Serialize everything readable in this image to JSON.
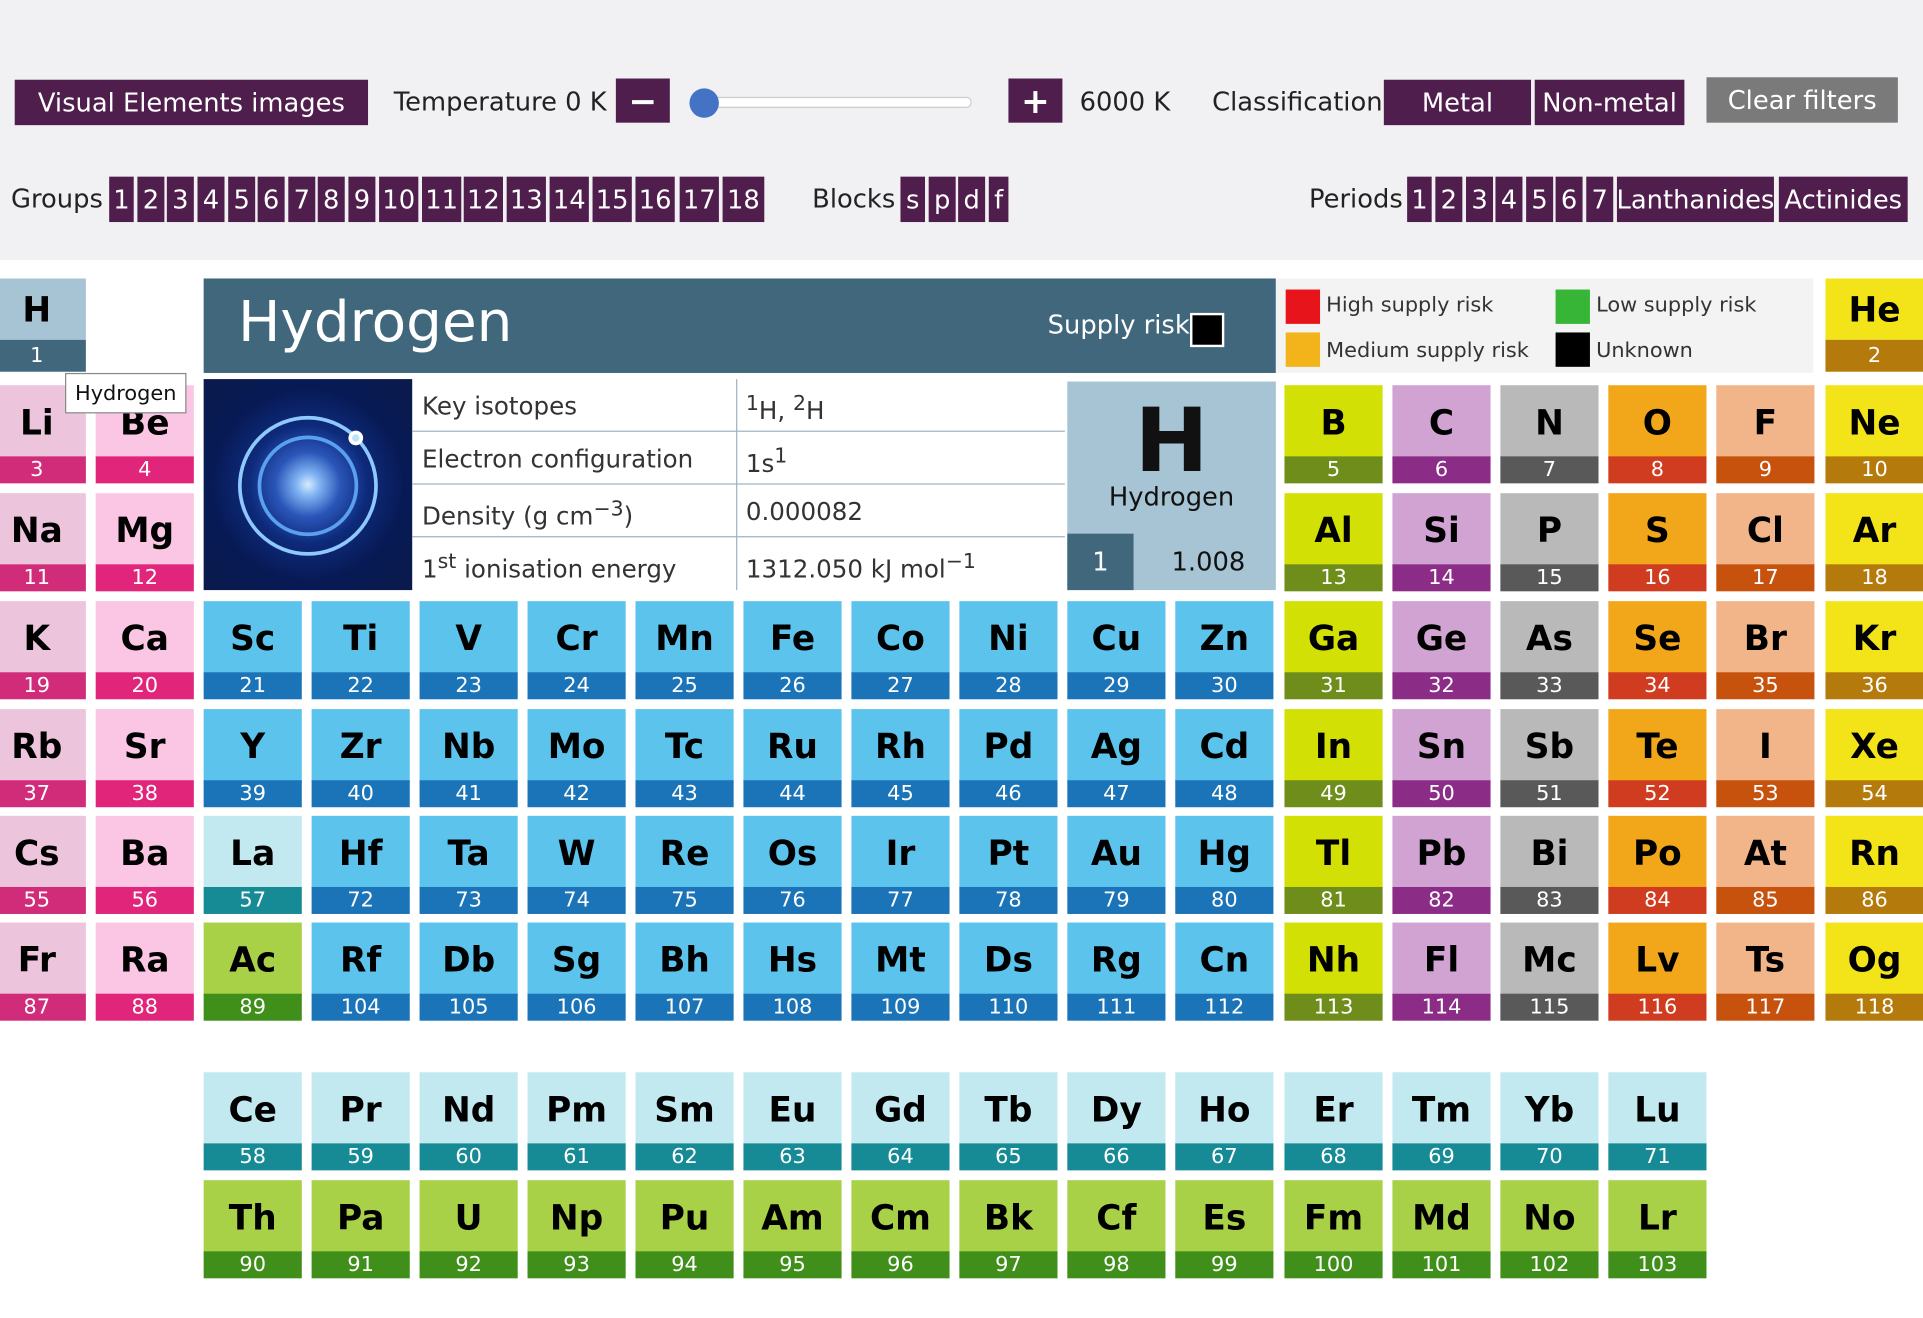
{
  "controls": {
    "images_button": "Visual Elements images",
    "temperature_label": "Temperature 0 K",
    "minus": "−",
    "plus": "+",
    "temperature_max": "6000 K",
    "classification_label": "Classification",
    "metal": "Metal",
    "non_metal": "Non-metal",
    "clear": "Clear filters",
    "temperature_slider_level": 0
  },
  "filters": {
    "groups_label": "Groups",
    "groups": [
      "1",
      "2",
      "3",
      "4",
      "5",
      "6",
      "7",
      "8",
      "9",
      "10",
      "11",
      "12",
      "13",
      "14",
      "15",
      "16",
      "17",
      "18"
    ],
    "blocks_label": "Blocks",
    "blocks": [
      "s",
      "p",
      "d",
      "f"
    ],
    "periods_label": "Periods",
    "periods": [
      "1",
      "2",
      "3",
      "4",
      "5",
      "6",
      "7",
      "Lanthanides",
      "Actinides"
    ]
  },
  "detail": {
    "name": "Hydrogen",
    "supply_risk_label": "Supply risk",
    "symbol": "H",
    "atomic_number": "1",
    "atomic_mass": "1.008",
    "properties": [
      {
        "key": "Key isotopes",
        "value": "1H, 2H"
      },
      {
        "key": "Electron configuration",
        "value": "1s1"
      },
      {
        "key": "Density (g cm−3)",
        "value": "0.000082"
      },
      {
        "key": "1st ionisation energy",
        "value": "1312.050 kJ mol−1"
      }
    ]
  },
  "legend": {
    "high": "High supply risk",
    "medium": "Medium supply risk",
    "low": "Low supply risk",
    "unknown": "Unknown",
    "colors": {
      "high": "#e8141c",
      "medium": "#f2b31b",
      "low": "#36b536",
      "unknown": "#000000"
    }
  },
  "tooltip": "Hydrogen",
  "colors": {
    "accent": "#4f1e4c",
    "detail_header": "#40677c",
    "alkali": [
      "#ecc4dc",
      "#d12c79"
    ],
    "alkaline": [
      "#fac6e3",
      "#e0257a"
    ],
    "transition": [
      "#5cc4ec",
      "#1b74b8"
    ],
    "lanthanide": [
      "#c2e9f0",
      "#178b95"
    ],
    "actinide": [
      "#a8d147",
      "#3f8f1a"
    ],
    "post_transition": [
      "#d3e005",
      "#6f8d1a"
    ],
    "metalloid": [
      "#d1a3d3",
      "#8b2d87"
    ],
    "nonmetal_grey": [
      "#b9b9b9",
      "#595959"
    ],
    "orange": [
      "#f2a71b",
      "#d03c1f"
    ],
    "halogen": [
      "#f2b58a",
      "#c6520e"
    ],
    "noble": [
      "#f2e418",
      "#b57a0c"
    ],
    "hydrogen": [
      "#a7c4d4",
      "#40677c"
    ]
  },
  "elements": [
    {
      "s": "H",
      "n": "1",
      "c": "hydrogen"
    },
    {
      "s": "He",
      "n": "2",
      "c": "noble"
    },
    {
      "s": "Li",
      "n": "3",
      "c": "alkali"
    },
    {
      "s": "Be",
      "n": "4",
      "c": "alkaline"
    },
    {
      "s": "B",
      "n": "5",
      "c": "post_transition"
    },
    {
      "s": "C",
      "n": "6",
      "c": "metalloid"
    },
    {
      "s": "N",
      "n": "7",
      "c": "nonmetal_grey"
    },
    {
      "s": "O",
      "n": "8",
      "c": "orange"
    },
    {
      "s": "F",
      "n": "9",
      "c": "halogen"
    },
    {
      "s": "Ne",
      "n": "10",
      "c": "noble"
    },
    {
      "s": "Na",
      "n": "11",
      "c": "alkali"
    },
    {
      "s": "Mg",
      "n": "12",
      "c": "alkaline"
    },
    {
      "s": "Al",
      "n": "13",
      "c": "post_transition"
    },
    {
      "s": "Si",
      "n": "14",
      "c": "metalloid"
    },
    {
      "s": "P",
      "n": "15",
      "c": "nonmetal_grey"
    },
    {
      "s": "S",
      "n": "16",
      "c": "orange"
    },
    {
      "s": "Cl",
      "n": "17",
      "c": "halogen"
    },
    {
      "s": "Ar",
      "n": "18",
      "c": "noble"
    },
    {
      "s": "K",
      "n": "19",
      "c": "alkali"
    },
    {
      "s": "Ca",
      "n": "20",
      "c": "alkaline"
    },
    {
      "s": "Sc",
      "n": "21",
      "c": "transition"
    },
    {
      "s": "Ti",
      "n": "22",
      "c": "transition"
    },
    {
      "s": "V",
      "n": "23",
      "c": "transition"
    },
    {
      "s": "Cr",
      "n": "24",
      "c": "transition"
    },
    {
      "s": "Mn",
      "n": "25",
      "c": "transition"
    },
    {
      "s": "Fe",
      "n": "26",
      "c": "transition"
    },
    {
      "s": "Co",
      "n": "27",
      "c": "transition"
    },
    {
      "s": "Ni",
      "n": "28",
      "c": "transition"
    },
    {
      "s": "Cu",
      "n": "29",
      "c": "transition"
    },
    {
      "s": "Zn",
      "n": "30",
      "c": "transition"
    },
    {
      "s": "Ga",
      "n": "31",
      "c": "post_transition"
    },
    {
      "s": "Ge",
      "n": "32",
      "c": "metalloid"
    },
    {
      "s": "As",
      "n": "33",
      "c": "nonmetal_grey"
    },
    {
      "s": "Se",
      "n": "34",
      "c": "orange"
    },
    {
      "s": "Br",
      "n": "35",
      "c": "halogen"
    },
    {
      "s": "Kr",
      "n": "36",
      "c": "noble"
    },
    {
      "s": "Rb",
      "n": "37",
      "c": "alkali"
    },
    {
      "s": "Sr",
      "n": "38",
      "c": "alkaline"
    },
    {
      "s": "Y",
      "n": "39",
      "c": "transition"
    },
    {
      "s": "Zr",
      "n": "40",
      "c": "transition"
    },
    {
      "s": "Nb",
      "n": "41",
      "c": "transition"
    },
    {
      "s": "Mo",
      "n": "42",
      "c": "transition"
    },
    {
      "s": "Tc",
      "n": "43",
      "c": "transition"
    },
    {
      "s": "Ru",
      "n": "44",
      "c": "transition"
    },
    {
      "s": "Rh",
      "n": "45",
      "c": "transition"
    },
    {
      "s": "Pd",
      "n": "46",
      "c": "transition"
    },
    {
      "s": "Ag",
      "n": "47",
      "c": "transition"
    },
    {
      "s": "Cd",
      "n": "48",
      "c": "transition"
    },
    {
      "s": "In",
      "n": "49",
      "c": "post_transition"
    },
    {
      "s": "Sn",
      "n": "50",
      "c": "metalloid"
    },
    {
      "s": "Sb",
      "n": "51",
      "c": "nonmetal_grey"
    },
    {
      "s": "Te",
      "n": "52",
      "c": "orange"
    },
    {
      "s": "I",
      "n": "53",
      "c": "halogen"
    },
    {
      "s": "Xe",
      "n": "54",
      "c": "noble"
    },
    {
      "s": "Cs",
      "n": "55",
      "c": "alkali"
    },
    {
      "s": "Ba",
      "n": "56",
      "c": "alkaline"
    },
    {
      "s": "La",
      "n": "57",
      "c": "lanthanide"
    },
    {
      "s": "Hf",
      "n": "72",
      "c": "transition"
    },
    {
      "s": "Ta",
      "n": "73",
      "c": "transition"
    },
    {
      "s": "W",
      "n": "74",
      "c": "transition"
    },
    {
      "s": "Re",
      "n": "75",
      "c": "transition"
    },
    {
      "s": "Os",
      "n": "76",
      "c": "transition"
    },
    {
      "s": "Ir",
      "n": "77",
      "c": "transition"
    },
    {
      "s": "Pt",
      "n": "78",
      "c": "transition"
    },
    {
      "s": "Au",
      "n": "79",
      "c": "transition"
    },
    {
      "s": "Hg",
      "n": "80",
      "c": "transition"
    },
    {
      "s": "Tl",
      "n": "81",
      "c": "post_transition"
    },
    {
      "s": "Pb",
      "n": "82",
      "c": "metalloid"
    },
    {
      "s": "Bi",
      "n": "83",
      "c": "nonmetal_grey"
    },
    {
      "s": "Po",
      "n": "84",
      "c": "orange"
    },
    {
      "s": "At",
      "n": "85",
      "c": "halogen"
    },
    {
      "s": "Rn",
      "n": "86",
      "c": "noble"
    },
    {
      "s": "Fr",
      "n": "87",
      "c": "alkali"
    },
    {
      "s": "Ra",
      "n": "88",
      "c": "alkaline"
    },
    {
      "s": "Ac",
      "n": "89",
      "c": "actinide"
    },
    {
      "s": "Rf",
      "n": "104",
      "c": "transition"
    },
    {
      "s": "Db",
      "n": "105",
      "c": "transition"
    },
    {
      "s": "Sg",
      "n": "106",
      "c": "transition"
    },
    {
      "s": "Bh",
      "n": "107",
      "c": "transition"
    },
    {
      "s": "Hs",
      "n": "108",
      "c": "transition"
    },
    {
      "s": "Mt",
      "n": "109",
      "c": "transition"
    },
    {
      "s": "Ds",
      "n": "110",
      "c": "transition"
    },
    {
      "s": "Rg",
      "n": "111",
      "c": "transition"
    },
    {
      "s": "Cn",
      "n": "112",
      "c": "transition"
    },
    {
      "s": "Nh",
      "n": "113",
      "c": "post_transition"
    },
    {
      "s": "Fl",
      "n": "114",
      "c": "metalloid"
    },
    {
      "s": "Mc",
      "n": "115",
      "c": "nonmetal_grey"
    },
    {
      "s": "Lv",
      "n": "116",
      "c": "orange"
    },
    {
      "s": "Ts",
      "n": "117",
      "c": "halogen"
    },
    {
      "s": "Og",
      "n": "118",
      "c": "noble"
    },
    {
      "s": "Ce",
      "n": "58",
      "c": "lanthanide"
    },
    {
      "s": "Pr",
      "n": "59",
      "c": "lanthanide"
    },
    {
      "s": "Nd",
      "n": "60",
      "c": "lanthanide"
    },
    {
      "s": "Pm",
      "n": "61",
      "c": "lanthanide"
    },
    {
      "s": "Sm",
      "n": "62",
      "c": "lanthanide"
    },
    {
      "s": "Eu",
      "n": "63",
      "c": "lanthanide"
    },
    {
      "s": "Gd",
      "n": "64",
      "c": "lanthanide"
    },
    {
      "s": "Tb",
      "n": "65",
      "c": "lanthanide"
    },
    {
      "s": "Dy",
      "n": "66",
      "c": "lanthanide"
    },
    {
      "s": "Ho",
      "n": "67",
      "c": "lanthanide"
    },
    {
      "s": "Er",
      "n": "68",
      "c": "lanthanide"
    },
    {
      "s": "Tm",
      "n": "69",
      "c": "lanthanide"
    },
    {
      "s": "Yb",
      "n": "70",
      "c": "lanthanide"
    },
    {
      "s": "Lu",
      "n": "71",
      "c": "lanthanide"
    },
    {
      "s": "Th",
      "n": "90",
      "c": "actinide"
    },
    {
      "s": "Pa",
      "n": "91",
      "c": "actinide"
    },
    {
      "s": "U",
      "n": "92",
      "c": "actinide"
    },
    {
      "s": "Np",
      "n": "93",
      "c": "actinide"
    },
    {
      "s": "Pu",
      "n": "94",
      "c": "actinide"
    },
    {
      "s": "Am",
      "n": "95",
      "c": "actinide"
    },
    {
      "s": "Cm",
      "n": "96",
      "c": "actinide"
    },
    {
      "s": "Bk",
      "n": "97",
      "c": "actinide"
    },
    {
      "s": "Cf",
      "n": "98",
      "c": "actinide"
    },
    {
      "s": "Es",
      "n": "99",
      "c": "actinide"
    },
    {
      "s": "Fm",
      "n": "100",
      "c": "actinide"
    },
    {
      "s": "Md",
      "n": "101",
      "c": "actinide"
    },
    {
      "s": "No",
      "n": "102",
      "c": "actinide"
    },
    {
      "s": "Lr",
      "n": "103",
      "c": "actinide"
    }
  ]
}
